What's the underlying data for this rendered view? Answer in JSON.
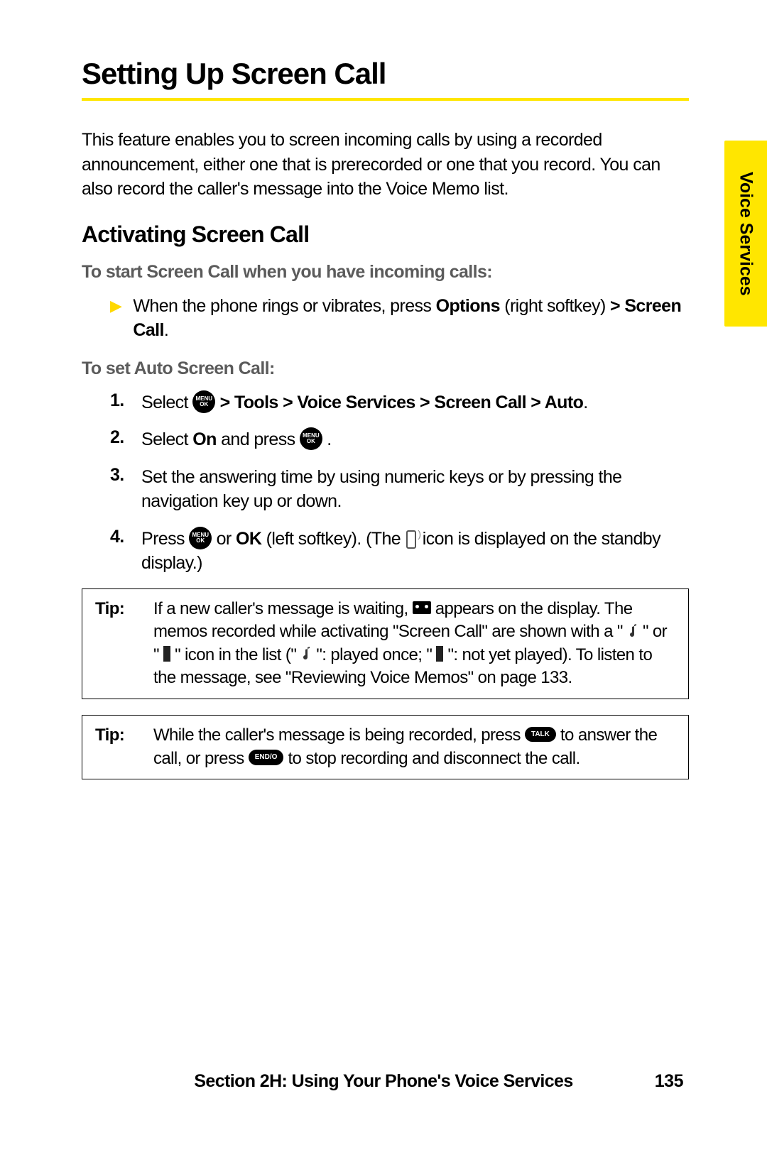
{
  "side_tab": "Voice Services",
  "title": "Setting Up Screen Call",
  "intro": "This feature enables you to screen incoming calls by using a recorded announcement, either one that is prerecorded or one that you record. You can also record the caller's message into the Voice Memo list.",
  "subheading": "Activating Screen Call",
  "lead1": "To start Screen Call when you have incoming calls:",
  "bullet1": {
    "pre": "When the phone rings or vibrates, press ",
    "b1": "Options",
    "mid": " (right softkey) ",
    "b2": "> Screen Call",
    "post": "."
  },
  "lead2": "To set Auto Screen Call:",
  "steps": {
    "s1": {
      "num": "1.",
      "pre": "Select  ",
      "b": " > Tools > Voice Services > Screen Call > Auto",
      "post": "."
    },
    "s2": {
      "num": "2.",
      "pre": "Select ",
      "b": "On",
      "mid": " and press ",
      "post": " ."
    },
    "s3": {
      "num": "3.",
      "text": "Set the answering time by using numeric keys or by pressing the navigation key up or down."
    },
    "s4": {
      "num": "4.",
      "pre": "Press ",
      "mid1": "  or ",
      "b": "OK",
      "mid2": " (left softkey). (The  ",
      "post": "  icon is displayed on the standby display.)"
    }
  },
  "tip1": {
    "label": "Tip:",
    "t1": "If a new caller's message is waiting, ",
    "t2": " appears on the display. The memos recorded while activating \"Screen Call\" are shown with a \" ",
    "t3": " \" or \" ",
    "t4": " \" icon in the list (\" ",
    "t5": " \": played once; \" ",
    "t6": " \": not yet played). To listen to the message, see \"Reviewing Voice Memos\" on page 133."
  },
  "tip2": {
    "label": "Tip:",
    "t1": "While the caller's message is being recorded, press ",
    "t2": " to answer the call, or press ",
    "t3": " to stop recording and disconnect the call."
  },
  "button_labels": {
    "menu": "MENU\nOK",
    "talk": "TALK",
    "end": "END/O"
  },
  "footer": "Section 2H: Using Your Phone's Voice Services",
  "page_num": "135"
}
